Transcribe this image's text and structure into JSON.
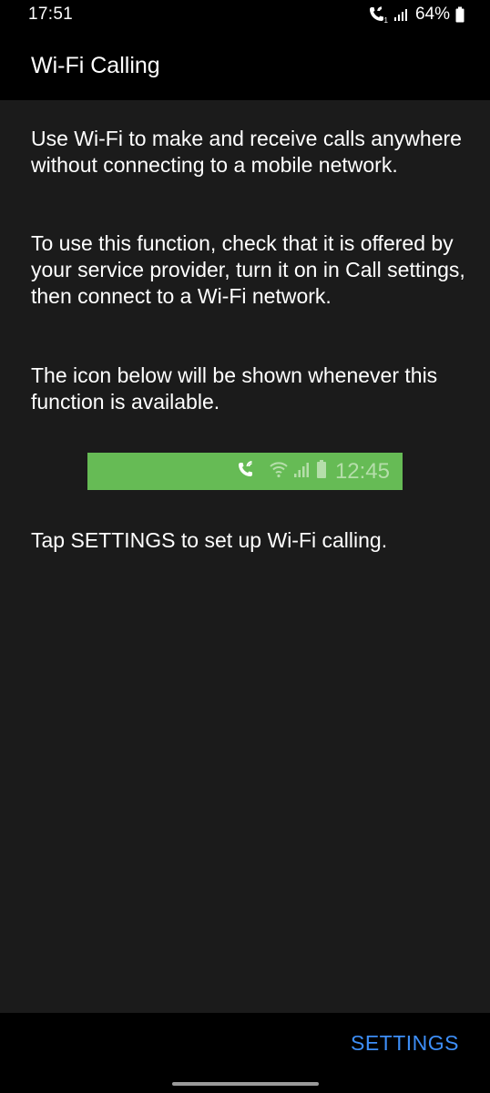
{
  "status_bar": {
    "time": "17:51",
    "battery": "64%",
    "icons": [
      "wifi-call-icon",
      "signal-icon",
      "battery-icon"
    ]
  },
  "app_bar": {
    "title": "Wi-Fi Calling"
  },
  "content": {
    "paragraph1": "Use Wi-Fi to make and receive calls anywhere without connecting to a mobile network.",
    "paragraph2": "To use this function, check that it is offered by your service provider, turn it on in Call settings, then connect to a Wi-Fi network.",
    "paragraph3": "The icon below will be shown whenever this function is available.",
    "preview": {
      "time": "12:45",
      "background_color": "#66bb55",
      "icons": [
        "wifi-call-icon",
        "wifi-icon",
        "signal-icon",
        "battery-icon"
      ]
    },
    "paragraph4": "Tap SETTINGS to set up Wi-Fi calling."
  },
  "bottom_bar": {
    "settings_label": "SETTINGS",
    "accent_color": "#3d8ef7"
  }
}
